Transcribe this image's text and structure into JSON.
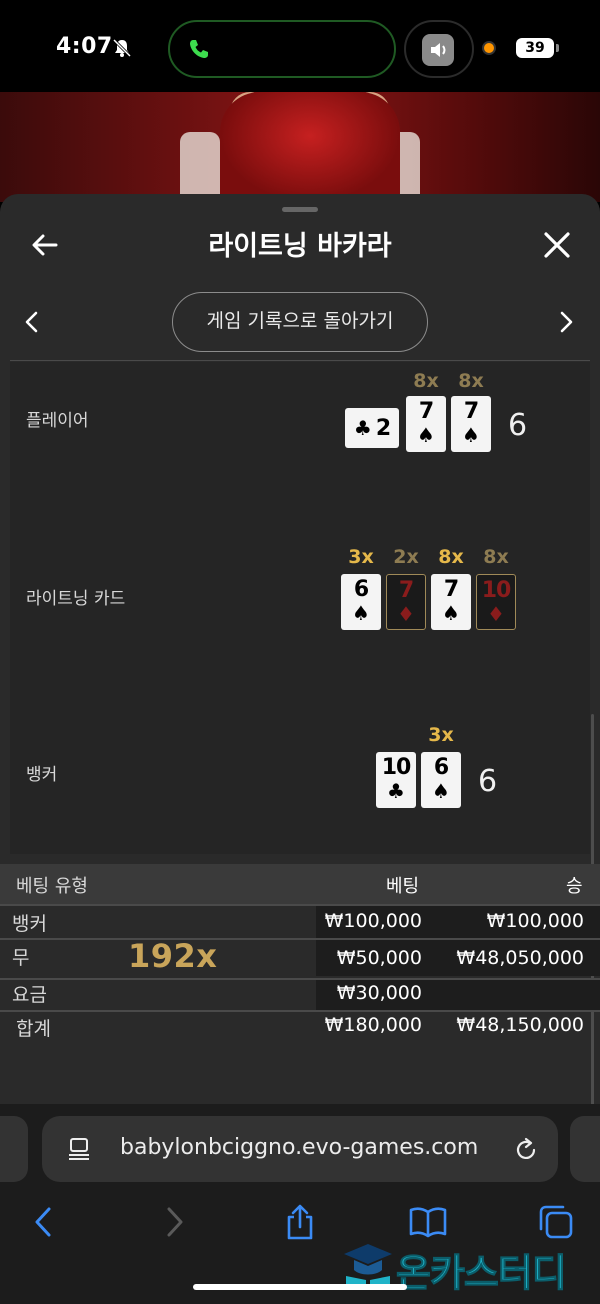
{
  "status_bar": {
    "time": "4:07",
    "battery": "39"
  },
  "sheet": {
    "title": "라이트닝 바카라",
    "history_button": "게임 기록으로 돌아가기"
  },
  "results": {
    "player": {
      "label": "플레이어",
      "score": "6",
      "cards": [
        {
          "rank": "2",
          "suit": "♣",
          "orientation": "sideways",
          "multiplier": ""
        },
        {
          "rank": "7",
          "suit": "♠",
          "multiplier": "8x"
        },
        {
          "rank": "7",
          "suit": "♠",
          "multiplier": "8x"
        }
      ]
    },
    "lightning": {
      "label": "라이트닝 카드",
      "cards": [
        {
          "rank": "6",
          "suit": "♠",
          "multiplier": "3x",
          "active": true
        },
        {
          "rank": "7",
          "suit": "♦",
          "multiplier": "2x",
          "active": false
        },
        {
          "rank": "7",
          "suit": "♠",
          "multiplier": "8x",
          "active": true
        },
        {
          "rank": "10",
          "suit": "♦",
          "multiplier": "8x",
          "active": false
        }
      ]
    },
    "banker": {
      "label": "뱅커",
      "score": "6",
      "cards": [
        {
          "rank": "10",
          "suit": "♣",
          "multiplier": ""
        },
        {
          "rank": "6",
          "suit": "♠",
          "multiplier": "3x"
        }
      ]
    }
  },
  "bet_table": {
    "headers": {
      "type": "베팅 유형",
      "bet": "베팅",
      "win": "승"
    },
    "rows": [
      {
        "type": "뱅커",
        "bet": "₩100,000",
        "win": "₩100,000"
      },
      {
        "type": "무",
        "bet": "₩50,000",
        "win": "₩48,050,000",
        "multiplier": "192x"
      },
      {
        "type": "요금",
        "bet": "₩30,000",
        "win": ""
      },
      {
        "type": "합계",
        "bet": "₩180,000",
        "win": "₩48,150,000"
      }
    ]
  },
  "browser": {
    "url": "babylonbciggno.evo-games.com"
  },
  "watermark": {
    "text": "온카스터디"
  },
  "colors": {
    "gold": "#e5b84a",
    "dim_gold": "#8e7c52",
    "sheet_bg": "#2a2a2a",
    "accent_blue": "#3b8bf5"
  }
}
